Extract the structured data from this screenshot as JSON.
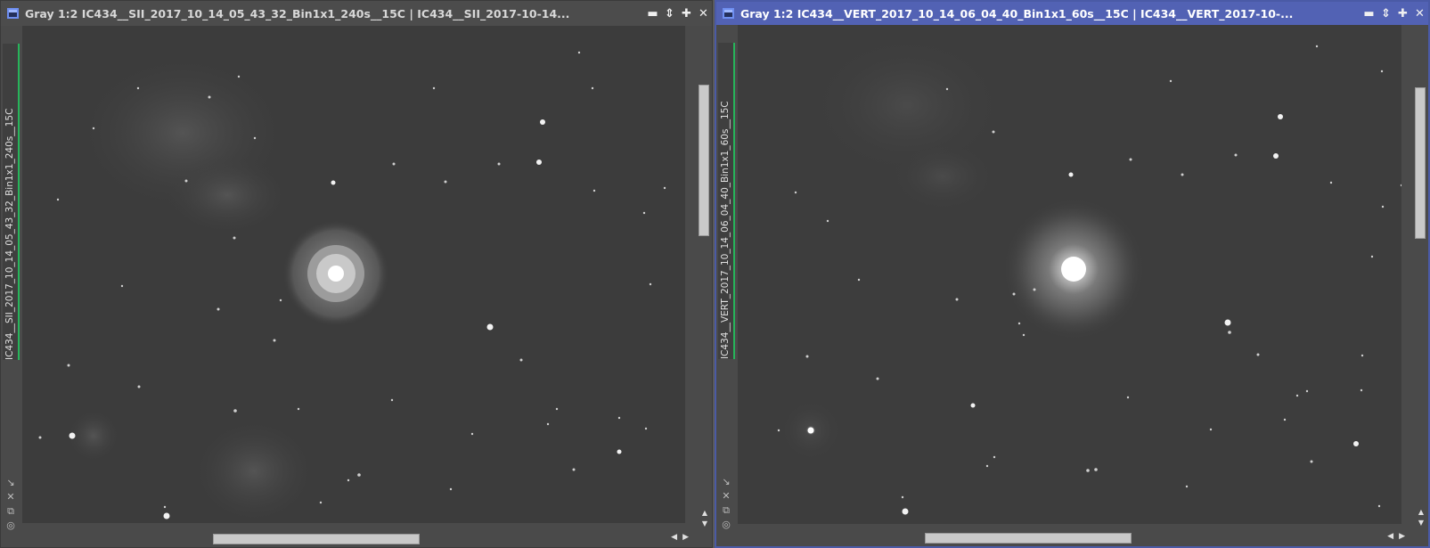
{
  "windows": [
    {
      "id": "left",
      "title": "Gray 1:2 IC434__SII_2017_10_14_05_43_32_Bin1x1_240s__15C | IC434__SII_2017-10-14...",
      "vertical_tab_label": "IC434__SII_2017_10_14_05_43_32_Bin1x1_240s__15C",
      "active": false
    },
    {
      "id": "right",
      "title": "Gray 1:2 IC434__VERT_2017_10_14_06_04_40_Bin1x1_60s__15C | IC434__VERT_2017-10-...",
      "vertical_tab_label": "IC434__VERT_2017_10_14_06_04_40_Bin1x1_60s__15C",
      "active": true
    }
  ],
  "titlebar_buttons": {
    "shade": "▬",
    "maximize_toggle": "⇕",
    "maximize": "✚",
    "close": "✕"
  },
  "sidebar_icons": [
    "resize-arrow-icon",
    "fit-view-icon",
    "clone-icon",
    "settings-icon"
  ],
  "colors": {
    "active_titlebar": "#5262b4",
    "inactive_titlebar": "#4c4c4c",
    "vertical_tab_accent": "#27b45a",
    "sky_background": "#3d3d3d"
  }
}
